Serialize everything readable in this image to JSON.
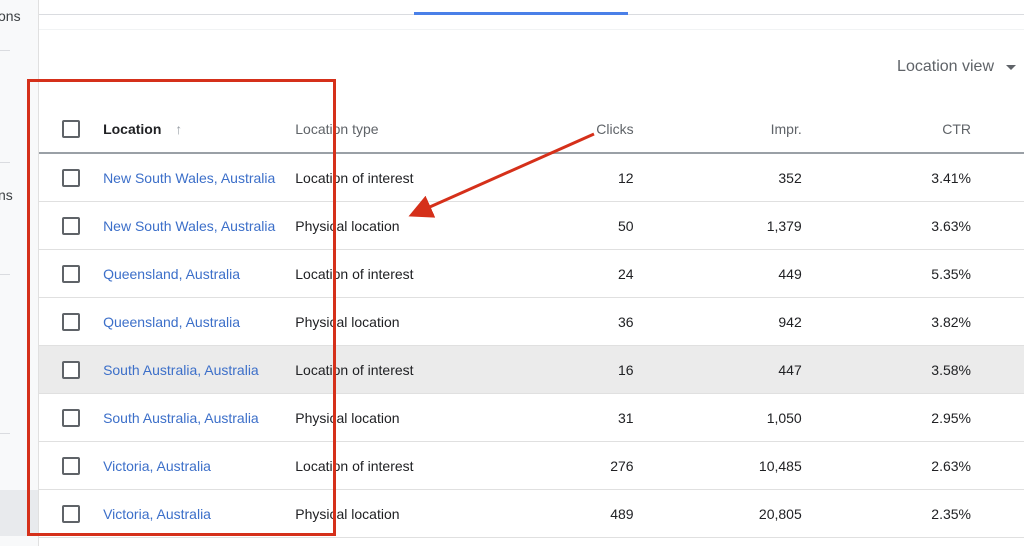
{
  "leftnav": {
    "fragments": [
      "ons",
      "ns"
    ]
  },
  "toolbar": {
    "view_label": "Location view"
  },
  "table": {
    "columns": {
      "location": "Location",
      "location_type": "Location type",
      "clicks": "Clicks",
      "impr": "Impr.",
      "ctr": "CTR"
    },
    "rows": [
      {
        "location": "New South Wales, Australia",
        "type": "Location of interest",
        "clicks": "12",
        "impr": "352",
        "ctr": "3.41%"
      },
      {
        "location": "New South Wales, Australia",
        "type": "Physical location",
        "clicks": "50",
        "impr": "1,379",
        "ctr": "3.63%"
      },
      {
        "location": "Queensland, Australia",
        "type": "Location of interest",
        "clicks": "24",
        "impr": "449",
        "ctr": "5.35%"
      },
      {
        "location": "Queensland, Australia",
        "type": "Physical location",
        "clicks": "36",
        "impr": "942",
        "ctr": "3.82%"
      },
      {
        "location": "South Australia, Australia",
        "type": "Location of interest",
        "clicks": "16",
        "impr": "447",
        "ctr": "3.58%"
      },
      {
        "location": "South Australia, Australia",
        "type": "Physical location",
        "clicks": "31",
        "impr": "1,050",
        "ctr": "2.95%"
      },
      {
        "location": "Victoria, Australia",
        "type": "Location of interest",
        "clicks": "276",
        "impr": "10,485",
        "ctr": "2.63%"
      },
      {
        "location": "Victoria, Australia",
        "type": "Physical location",
        "clicks": "489",
        "impr": "20,805",
        "ctr": "2.35%"
      }
    ]
  },
  "colors": {
    "link": "#3c6fc9",
    "annotation": "#d5301a",
    "tab_active": "#4a80e8",
    "row_hover": "#ebebeb"
  },
  "icons": {
    "sort": "arrow-up-icon",
    "dropdown": "caret-down-icon"
  }
}
